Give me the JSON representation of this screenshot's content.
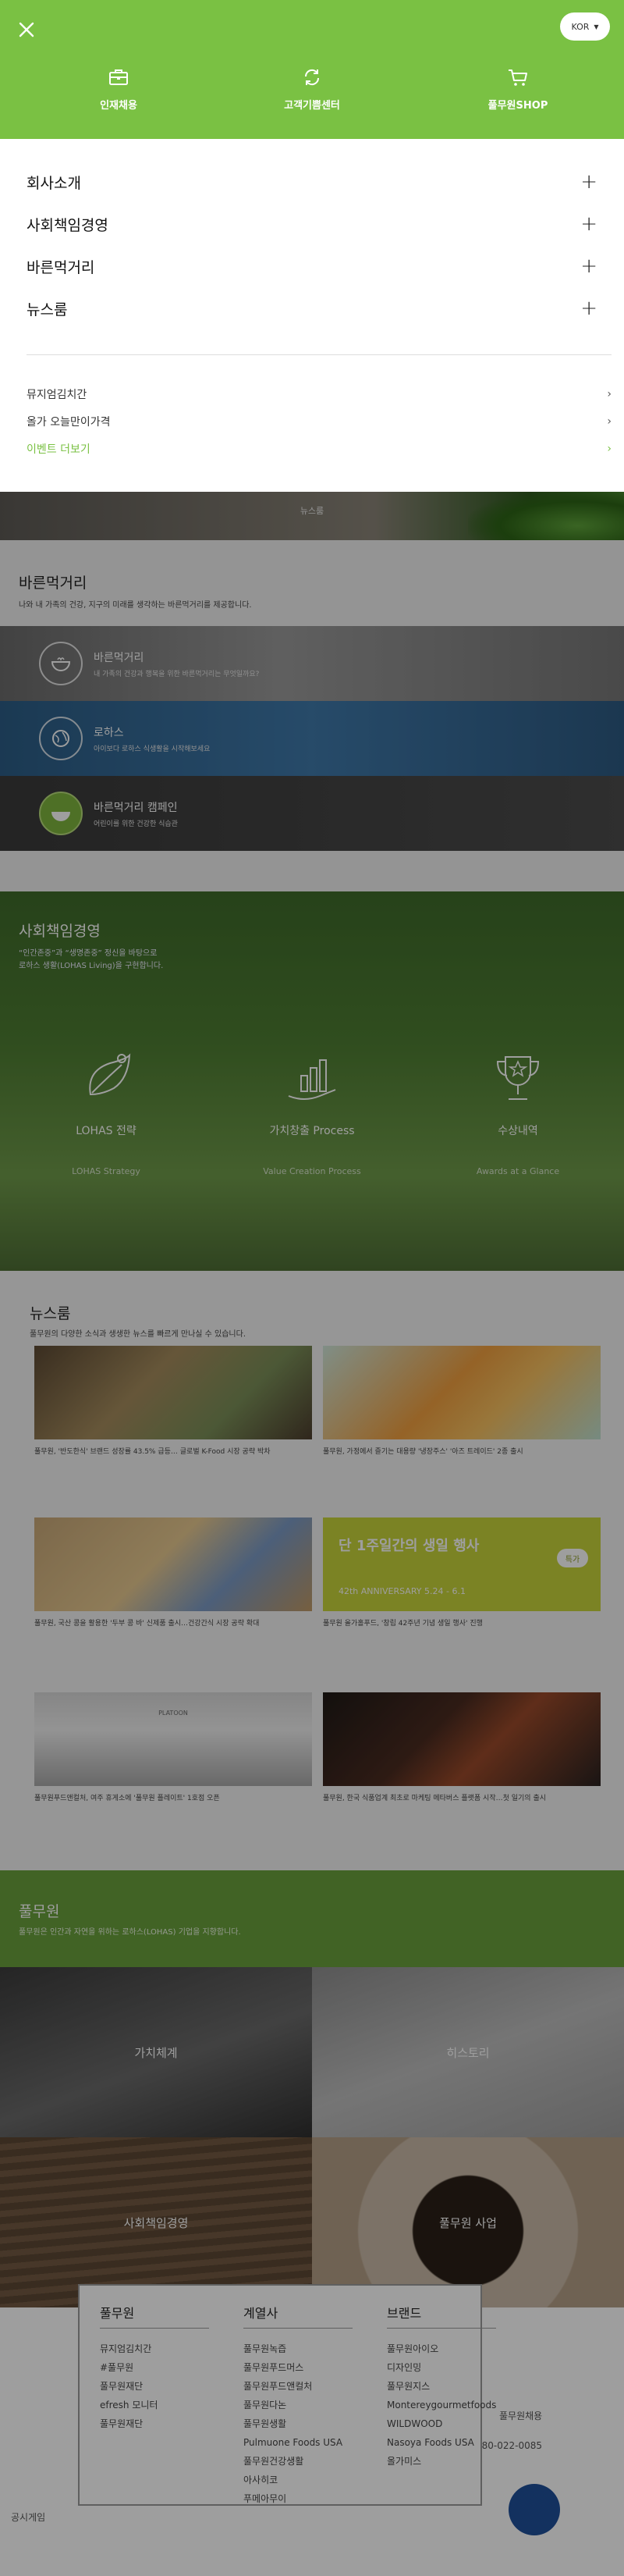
{
  "header": {
    "lang": "KOR",
    "quick_links": [
      {
        "label": "인재채용",
        "icon": "briefcase-icon"
      },
      {
        "label": "고객기쁨센터",
        "icon": "refresh-chat-icon"
      },
      {
        "label": "풀무원SHOP",
        "icon": "cart-icon"
      }
    ]
  },
  "menu": {
    "items": [
      "회사소개",
      "사회책임경영",
      "바른먹거리",
      "뉴스룸"
    ],
    "links": [
      "뮤지엄김치간",
      "올가 오늘만이가격",
      "이벤트 더보기"
    ]
  },
  "background": {
    "hero_caption": "뉴스룸",
    "eating": {
      "title": "바른먹거리",
      "desc": "나와 내 가족의 건강, 지구의 미래를 생각하는 바른먹거리를 제공합니다.",
      "stripes": [
        {
          "title": "바른먹거리",
          "desc": "내 가족의 건강과 행복을 위한 바른먹거리는 무엇일까요?"
        },
        {
          "title": "로하스",
          "desc": "아이보다 로하스 식생활을 시작해보세요"
        },
        {
          "title": "바른먹거리 캠페인",
          "desc": "어린이를 위한 건강한 식습관"
        }
      ]
    },
    "csr": {
      "title": "사회책임경영",
      "desc_1": "“인간존중”과 “생명존중” 정신을 바탕으로",
      "desc_2": "로하스 생활(LOHAS Living)을 구현합니다.",
      "items": [
        {
          "title": "LOHAS 전략",
          "sub": "LOHAS Strategy"
        },
        {
          "title": "가치창출 Process",
          "sub": "Value Creation Process"
        },
        {
          "title": "수상내역",
          "sub": "Awards at a Glance"
        }
      ]
    },
    "news": {
      "title": "뉴스룸",
      "desc": "풀무원의 다양한 소식과 생생한 뉴스를 빠르게 만나실 수 있습니다.",
      "cards": [
        {
          "caption": "풀무원, '반도한식' 브랜드 성장률 43.5% 급등… 글로벌 K-Food 시장 공략 박차"
        },
        {
          "caption": "풀무원, 가정에서 즐기는 대용량 '냉장주스' '아즈 트레이드' 2종 출시"
        },
        {
          "caption": "풀무원, 국산 콩을 활용한 '두부 콩 바' 신제품 출시…건강간식 시장 공략 확대"
        },
        {
          "caption": "풀무원 올가홀푸드, '창립 42주년 기념 생일 행사' 진행"
        },
        {
          "caption": "풀무원푸드앤컬처, 여주 휴게소에 '풀무원 플레이트' 1호점 오픈"
        },
        {
          "caption": "풀무원, 한국 식품업계 최초로 마케팅 메타버스 플랫폼 시작…첫 일기의 출시"
        }
      ],
      "banners": [
        "단 1주일간의 생일 행사",
        "42th ANNIVERSARY 5.24 - 6.1",
        "특가",
        "PLATOON"
      ]
    },
    "brand": {
      "title": "풀무원",
      "desc": "풀무원은 인간과 자연을 위하는 로하스(LOHAS) 기업을 지향합니다."
    },
    "tiles": [
      "가치체계",
      "히스토리",
      "사회책임경영",
      "풀무원 사업"
    ],
    "footer": {
      "columns": [
        {
          "heading": "풀무원",
          "links": [
            "뮤지엄김치간",
            "#풀무원",
            "풀무원재단",
            "efresh 모니터",
            "풀무원재단"
          ]
        },
        {
          "heading": "계열사",
          "links": [
            "풀무원녹즙",
            "풀무원푸드머스",
            "풀무원푸드앤컬처",
            "풀무원다논",
            "풀무원생활",
            "Pulmuone Foods USA",
            "풀무원건강생활",
            "아사히코",
            "푸메아무이"
          ]
        },
        {
          "heading": "브랜드",
          "links": [
            "풀무원아이오",
            "디자인밍",
            "풀무원지스",
            "Montereygourmetfoods",
            "WILDWOOD",
            "Nasoya Foods USA",
            "올가미스"
          ]
        }
      ],
      "recruit": "풀무원채용",
      "phone": "080-022-0085",
      "notice": "공시게임"
    }
  }
}
